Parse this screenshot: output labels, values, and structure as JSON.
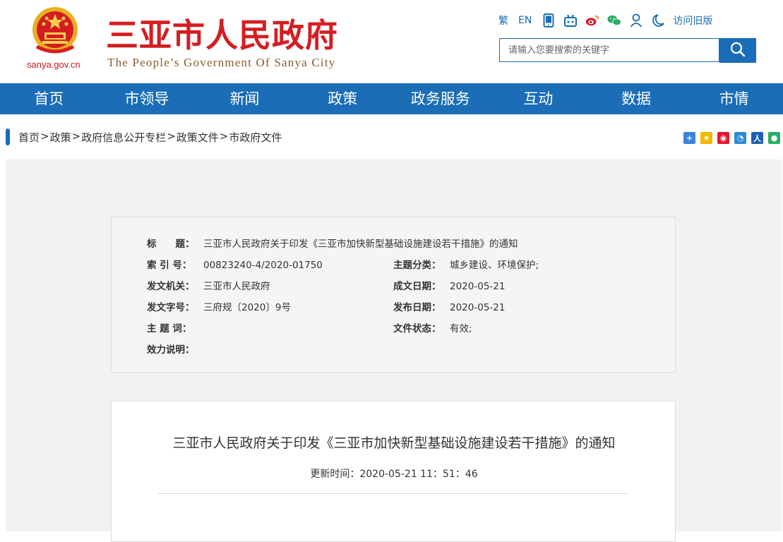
{
  "header": {
    "domain": "sanya.gov.cn",
    "title": "三亚市人民政府",
    "subtitle": "The People’s Government Of Sanya City",
    "tools": {
      "traditional": "繁",
      "english": "EN",
      "old_version": "访问旧版"
    },
    "tool_icons": [
      "mobile-icon",
      "robot-icon",
      "weibo-icon",
      "wechat-icon",
      "user-icon",
      "moon-icon"
    ],
    "search_placeholder": "请输入您要搜索的关键字"
  },
  "nav": [
    "首页",
    "市领导",
    "新闻",
    "政策",
    "政务服务",
    "互动",
    "数据",
    "市情"
  ],
  "breadcrumb": [
    "首页",
    "政策",
    "政府信息公开专栏",
    "政策文件",
    "市政府文件"
  ],
  "breadcrumb_sep": ">",
  "share_icons": [
    "share-plus-icon",
    "qzone-icon",
    "weibo-icon",
    "tencent-icon",
    "renren-icon",
    "wechat-icon"
  ],
  "info": {
    "title_label": "标　　题：",
    "title_value": "三亚市人民政府关于印发《三亚市加快新型基础设施建设若干措施》的通知",
    "index_label": "索 引 号：",
    "index_value": "00823240-4/2020-01750",
    "category_label": "主题分类：",
    "category_value": "城乡建设、环境保护;",
    "issuer_label": "发文机关：",
    "issuer_value": "三亚市人民政府",
    "written_label": "成文日期：",
    "written_value": "2020-05-21",
    "docno_label": "发文字号：",
    "docno_value": "三府规〔2020〕9号",
    "published_label": "发布日期：",
    "published_value": "2020-05-21",
    "keywords_label": "主 题 词：",
    "keywords_value": "",
    "status_label": "文件状态：",
    "status_value": "有效;",
    "validity_label": "效力说明：",
    "validity_value": ""
  },
  "article": {
    "title": "三亚市人民政府关于印发《三亚市加快新型基础设施建设若干措施》的通知",
    "update": "更新时间：2020-05-21 11：51：46"
  },
  "colors": {
    "brand_blue": "#1a6db6",
    "brand_red": "#d51d21"
  }
}
